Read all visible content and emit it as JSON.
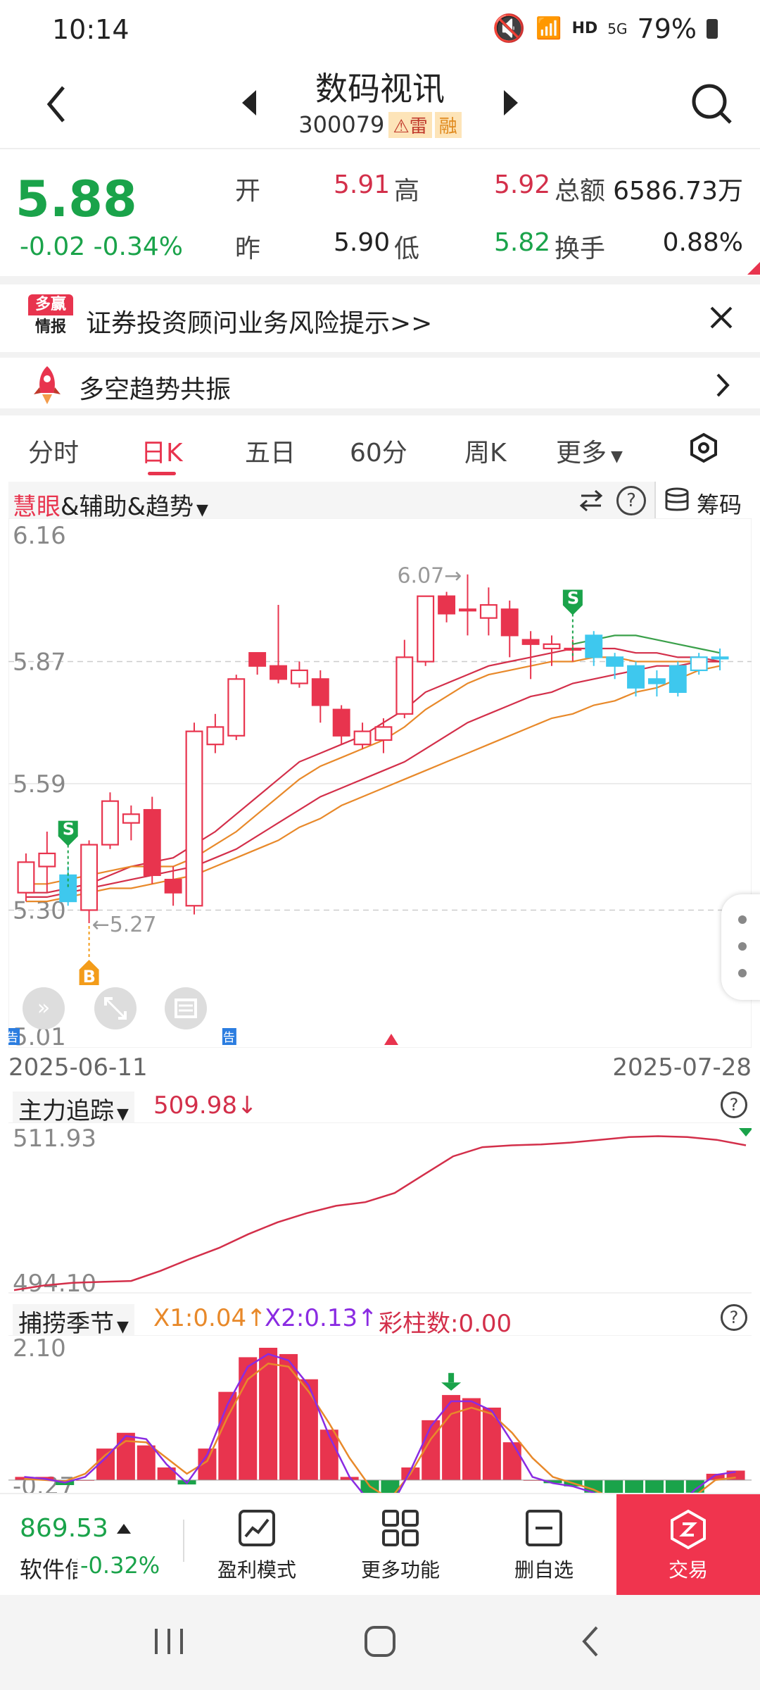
{
  "status_bar": {
    "time": "10:14",
    "hd": "HD",
    "net": "5G",
    "battery": "79%"
  },
  "header": {
    "title": "数码视讯",
    "code": "300079",
    "tag_risk": "雷",
    "tag_margin": "融"
  },
  "quote": {
    "price": "5.88",
    "change": "-0.02",
    "change_pct": "-0.34%",
    "open_label": "开",
    "open": "5.91",
    "high_label": "高",
    "high": "5.92",
    "amount_label": "总额",
    "amount": "6586.73万",
    "prev_label": "昨",
    "prev": "5.90",
    "low_label": "低",
    "low": "5.82",
    "turnover_label": "换手",
    "turnover": "0.88%"
  },
  "banner": {
    "logo_top": "多赢",
    "logo_bottom": "情报",
    "text": "证券投资顾问业务风险提示>>"
  },
  "banner2": {
    "text": "多空趋势共振"
  },
  "tabs": [
    {
      "label": "分时"
    },
    {
      "label": "日K"
    },
    {
      "label": "五日"
    },
    {
      "label": "60分"
    },
    {
      "label": "周K"
    },
    {
      "label": "更多"
    }
  ],
  "main_chart": {
    "indicator_a": "慧眼",
    "indicator_b": "&辅助&趋势",
    "chips_label": "筹码",
    "y_labels": [
      "6.16",
      "5.87",
      "5.59",
      "5.30",
      "5.01"
    ],
    "marker_high": "6.07→",
    "marker_low": "←5.27",
    "signal_s": "S",
    "signal_b": "B",
    "notice_label": "告",
    "date_start": "2025-06-11",
    "date_end": "2025-07-28"
  },
  "chart_data": [
    {
      "type": "candlestick",
      "title": "",
      "dates_range": [
        "2025-06-11",
        "2025-07-28"
      ],
      "ylim": [
        5.01,
        6.16
      ],
      "candles": [
        {
          "o": 5.34,
          "c": 5.41,
          "h": 5.43,
          "l": 5.32
        },
        {
          "o": 5.4,
          "c": 5.43,
          "h": 5.48,
          "l": 5.34
        },
        {
          "o": 5.38,
          "c": 5.32,
          "h": 5.4,
          "l": 5.31
        },
        {
          "o": 5.3,
          "c": 5.45,
          "h": 5.46,
          "l": 5.27
        },
        {
          "o": 5.45,
          "c": 5.55,
          "h": 5.57,
          "l": 5.44
        },
        {
          "o": 5.5,
          "c": 5.52,
          "h": 5.54,
          "l": 5.46
        },
        {
          "o": 5.53,
          "c": 5.38,
          "h": 5.56,
          "l": 5.36
        },
        {
          "o": 5.37,
          "c": 5.34,
          "h": 5.4,
          "l": 5.31
        },
        {
          "o": 5.31,
          "c": 5.71,
          "h": 5.73,
          "l": 5.29
        },
        {
          "o": 5.68,
          "c": 5.72,
          "h": 5.75,
          "l": 5.66
        },
        {
          "o": 5.7,
          "c": 5.83,
          "h": 5.84,
          "l": 5.69
        },
        {
          "o": 5.89,
          "c": 5.86,
          "h": 5.89,
          "l": 5.84
        },
        {
          "o": 5.86,
          "c": 5.83,
          "h": 6.0,
          "l": 5.82
        },
        {
          "o": 5.82,
          "c": 5.85,
          "h": 5.87,
          "l": 5.81
        },
        {
          "o": 5.83,
          "c": 5.77,
          "h": 5.85,
          "l": 5.73
        },
        {
          "o": 5.76,
          "c": 5.7,
          "h": 5.77,
          "l": 5.68
        },
        {
          "o": 5.68,
          "c": 5.71,
          "h": 5.73,
          "l": 5.67
        },
        {
          "o": 5.69,
          "c": 5.72,
          "h": 5.74,
          "l": 5.66
        },
        {
          "o": 5.75,
          "c": 5.88,
          "h": 5.92,
          "l": 5.74
        },
        {
          "o": 5.87,
          "c": 6.02,
          "h": 6.02,
          "l": 5.86
        },
        {
          "o": 6.02,
          "c": 5.98,
          "h": 6.03,
          "l": 5.96
        },
        {
          "o": 5.99,
          "c": 5.99,
          "h": 6.07,
          "l": 5.93
        },
        {
          "o": 5.97,
          "c": 6.0,
          "h": 6.04,
          "l": 5.93
        },
        {
          "o": 5.99,
          "c": 5.93,
          "h": 6.01,
          "l": 5.88
        },
        {
          "o": 5.92,
          "c": 5.91,
          "h": 5.94,
          "l": 5.83
        },
        {
          "o": 5.9,
          "c": 5.91,
          "h": 5.93,
          "l": 5.86
        },
        {
          "o": 5.9,
          "c": 5.9,
          "h": 5.92,
          "l": 5.87
        },
        {
          "o": 5.88,
          "c": 5.93,
          "h": 5.94,
          "l": 5.86
        },
        {
          "o": 5.88,
          "c": 5.86,
          "h": 5.89,
          "l": 5.83
        },
        {
          "o": 5.86,
          "c": 5.81,
          "h": 5.87,
          "l": 5.79
        },
        {
          "o": 5.83,
          "c": 5.82,
          "h": 5.85,
          "l": 5.79
        },
        {
          "o": 5.86,
          "c": 5.8,
          "h": 5.87,
          "l": 5.79
        },
        {
          "o": 5.85,
          "c": 5.88,
          "h": 5.89,
          "l": 5.84
        },
        {
          "o": 5.88,
          "c": 5.88,
          "h": 5.9,
          "l": 5.85
        }
      ],
      "ma_series": [
        {
          "color": "#d32f4a",
          "values": [
            5.34,
            5.34,
            5.35,
            5.36,
            5.38,
            5.4,
            5.41,
            5.42,
            5.45,
            5.48,
            5.52,
            5.56,
            5.6,
            5.64,
            5.66,
            5.68,
            5.7,
            5.73,
            5.76,
            5.8,
            5.82,
            5.84,
            5.86,
            5.87,
            5.88,
            5.89,
            5.9,
            5.9,
            5.9,
            5.89,
            5.89,
            5.88,
            5.88,
            5.87
          ]
        },
        {
          "color": "#e8892a",
          "values": [
            5.36,
            5.36,
            5.37,
            5.38,
            5.39,
            5.4,
            5.4,
            5.4,
            5.42,
            5.45,
            5.48,
            5.52,
            5.56,
            5.6,
            5.63,
            5.65,
            5.67,
            5.69,
            5.72,
            5.76,
            5.79,
            5.82,
            5.84,
            5.85,
            5.86,
            5.87,
            5.87,
            5.88,
            5.88,
            5.87,
            5.87,
            5.87,
            5.87,
            5.87
          ]
        },
        {
          "color": "#d32f4a",
          "values": [
            5.33,
            5.33,
            5.34,
            5.35,
            5.36,
            5.37,
            5.38,
            5.39,
            5.4,
            5.42,
            5.44,
            5.47,
            5.5,
            5.53,
            5.56,
            5.58,
            5.6,
            5.62,
            5.64,
            5.67,
            5.7,
            5.73,
            5.75,
            5.77,
            5.79,
            5.8,
            5.82,
            5.83,
            5.84,
            5.85,
            5.86,
            5.86,
            5.87,
            5.87
          ]
        },
        {
          "color": "#e8892a",
          "values": [
            5.32,
            5.32,
            5.33,
            5.34,
            5.35,
            5.35,
            5.36,
            5.37,
            5.38,
            5.4,
            5.42,
            5.44,
            5.46,
            5.49,
            5.51,
            5.54,
            5.56,
            5.58,
            5.6,
            5.62,
            5.64,
            5.66,
            5.68,
            5.7,
            5.72,
            5.74,
            5.75,
            5.77,
            5.78,
            5.8,
            5.81,
            5.83,
            5.85,
            5.86
          ]
        },
        {
          "color": "#3aa04a",
          "values": [
            null,
            null,
            null,
            null,
            null,
            null,
            null,
            null,
            null,
            null,
            null,
            null,
            null,
            null,
            null,
            null,
            null,
            null,
            null,
            null,
            null,
            null,
            null,
            null,
            null,
            null,
            5.91,
            5.92,
            5.93,
            5.93,
            5.92,
            5.91,
            5.9,
            5.89
          ]
        }
      ]
    },
    {
      "type": "line",
      "title": "主力追踪",
      "current_value": "509.98↓",
      "y_labels": [
        "511.93",
        "494.10"
      ],
      "ylim": [
        494.1,
        511.93
      ],
      "series": [
        {
          "values": [
            494.4,
            494.9,
            495.2,
            495.3,
            495.4,
            496.5,
            497.8,
            499.0,
            500.5,
            501.8,
            502.8,
            503.6,
            504.0,
            505.0,
            507.0,
            509.0,
            510.0,
            510.2,
            510.3,
            510.5,
            510.8,
            511.1,
            511.2,
            511.1,
            510.8,
            510.2
          ]
        }
      ]
    },
    {
      "type": "bar",
      "title": "捕捞季节",
      "legend": [
        {
          "name": "X1:0.04↑",
          "color": "#e8892a"
        },
        {
          "name": "X2:0.13↑",
          "color": "#8a2be2"
        },
        {
          "name": "彩柱数:0.00",
          "color": "#d32f4a"
        }
      ],
      "y_labels": [
        "2.10",
        "-0.27"
      ],
      "ylim": [
        -0.27,
        2.1
      ],
      "values": [
        0.05,
        0.05,
        -0.08,
        0.0,
        0.5,
        0.75,
        0.55,
        0.2,
        -0.07,
        0.5,
        1.4,
        1.95,
        2.1,
        2.0,
        1.6,
        0.8,
        0.05,
        -0.4,
        -0.5,
        0.2,
        0.95,
        1.35,
        1.3,
        1.15,
        0.6,
        0.0,
        -0.05,
        -0.1,
        -0.2,
        -0.45,
        -0.55,
        -0.6,
        -0.5,
        -0.2,
        0.1,
        0.15
      ],
      "x1": [
        0.02,
        0.0,
        -0.02,
        0.1,
        0.4,
        0.62,
        0.6,
        0.35,
        0.1,
        0.3,
        1.0,
        1.6,
        1.85,
        1.8,
        1.4,
        0.9,
        0.35,
        -0.1,
        -0.3,
        0.1,
        0.65,
        1.05,
        1.15,
        1.05,
        0.75,
        0.35,
        0.05,
        -0.05,
        -0.15,
        -0.3,
        -0.42,
        -0.5,
        -0.45,
        -0.25,
        0.0,
        0.04
      ],
      "x2": [
        0.05,
        0.02,
        -0.04,
        0.05,
        0.35,
        0.7,
        0.65,
        0.25,
        -0.05,
        0.4,
        1.2,
        1.8,
        2.0,
        1.9,
        1.5,
        0.7,
        0.05,
        -0.35,
        -0.45,
        0.15,
        0.85,
        1.25,
        1.25,
        1.1,
        0.6,
        0.05,
        -0.05,
        -0.1,
        -0.2,
        -0.4,
        -0.5,
        -0.55,
        -0.45,
        -0.15,
        0.08,
        0.13
      ]
    }
  ],
  "sub_chart_1": {
    "name": "主力追踪",
    "value": "509.98↓",
    "y_top": "511.93",
    "y_bottom": "494.10"
  },
  "sub_chart_2": {
    "name": "捕捞季节",
    "x1": "X1:0.04↑",
    "x2": "X2:0.13↑",
    "bars": "彩柱数:0.00",
    "y_top": "2.10",
    "y_bottom": "-0.27"
  },
  "bottom_bar": {
    "index_value": "869.53",
    "index_name": "软件信",
    "index_change": "-0.32%",
    "items": [
      {
        "label": "盈利模式"
      },
      {
        "label": "更多功能"
      },
      {
        "label": "删自选"
      }
    ],
    "trade_label": "交易"
  }
}
